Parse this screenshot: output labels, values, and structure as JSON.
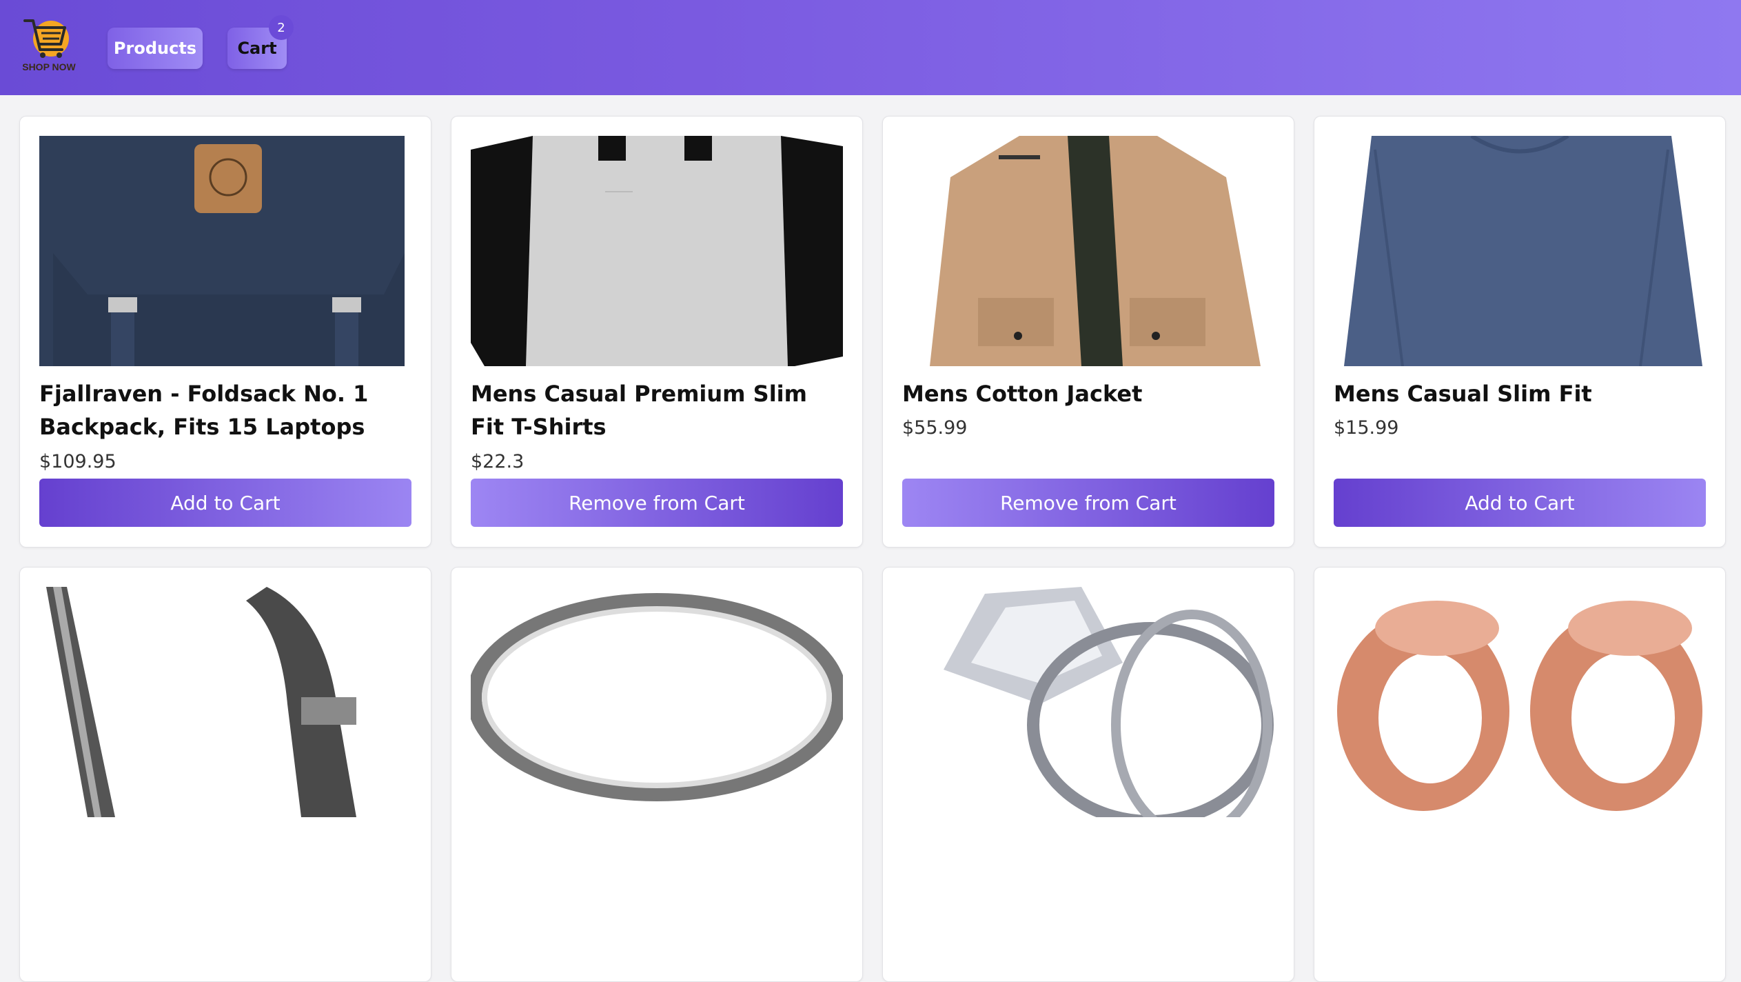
{
  "header": {
    "logo_text": "SHOP NOW",
    "nav": {
      "products_label": "Products",
      "cart_label": "Cart",
      "cart_count": "2"
    }
  },
  "products": [
    {
      "title": "Fjallraven - Foldsack No. 1 Backpack, Fits 15 Laptops",
      "price": "$109.95",
      "action": "Add to Cart"
    },
    {
      "title": "Mens Casual Premium Slim Fit T-Shirts",
      "price": "$22.3",
      "action": "Remove from Cart"
    },
    {
      "title": "Mens Cotton Jacket",
      "price": "$55.99",
      "action": "Remove from Cart"
    },
    {
      "title": "Mens Casual Slim Fit",
      "price": "$15.99",
      "action": "Add to Cart"
    }
  ],
  "colors": {
    "nav_start": "#6a4bd6",
    "nav_end": "#8f78f0",
    "button_dark": "#6540cf",
    "button_light": "#9b85f2"
  }
}
